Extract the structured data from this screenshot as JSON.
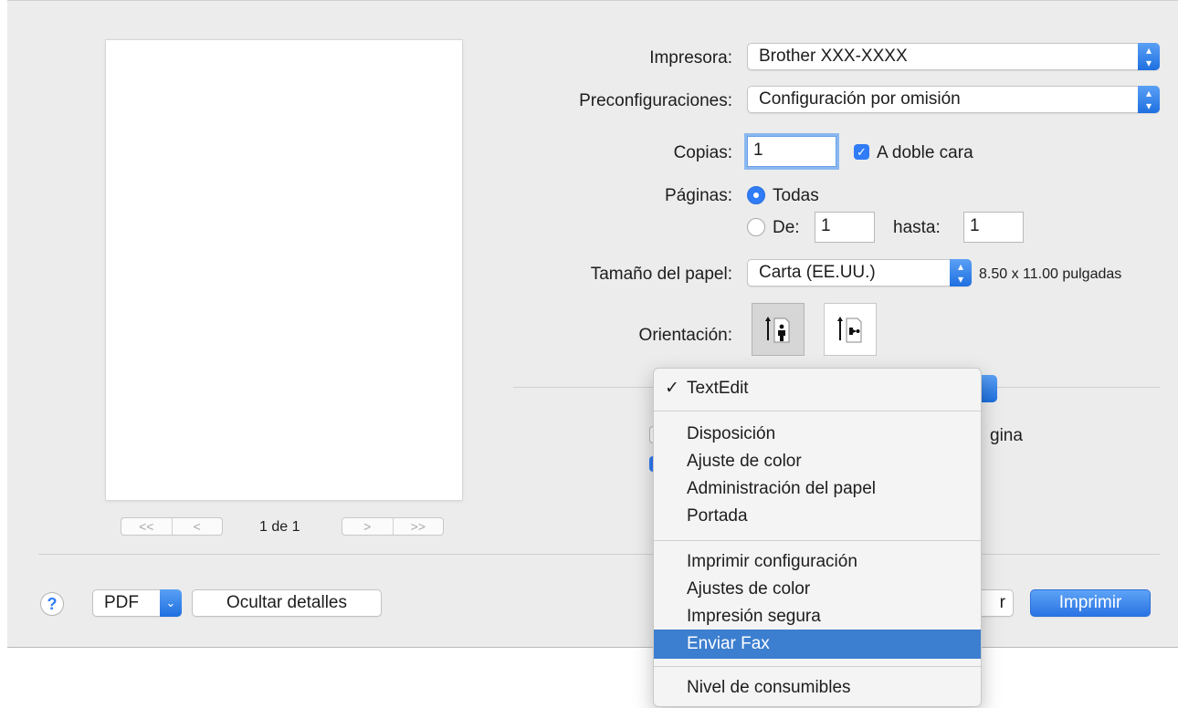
{
  "printer": {
    "label": "Impresora:",
    "value": "Brother XXX-XXXX"
  },
  "presets": {
    "label": "Preconfiguraciones:",
    "value": "Configuración por omisión"
  },
  "copies": {
    "label": "Copias:",
    "value": "1",
    "two_sided_label": "A doble cara",
    "two_sided_checked": true
  },
  "pages": {
    "label": "Páginas:",
    "all_label": "Todas",
    "from_label": "De:",
    "from_value": "1",
    "to_label": "hasta:",
    "to_value": "1"
  },
  "paper_size": {
    "label": "Tamaño del papel:",
    "value": "Carta (EE.UU.)",
    "dimensions": "8.50 x 11.00 pulgadas"
  },
  "orientation": {
    "label": "Orientación:",
    "selected": "portrait"
  },
  "preview": {
    "page_indicator": "1 de 1",
    "first": "<<",
    "prev": "<",
    "next": ">",
    "last": ">>"
  },
  "partial_behind_menu": {
    "right_text": "gina",
    "cancel_fragment": "r"
  },
  "menu": {
    "checked_item": "TextEdit",
    "check_mark": "✓",
    "group1": [
      "Disposición",
      "Ajuste de color",
      "Administración del papel",
      "Portada"
    ],
    "group2": [
      "Imprimir configuración",
      "Ajustes de color",
      "Impresión segura",
      "Enviar Fax"
    ],
    "group3": [
      "Nivel de consumibles"
    ],
    "highlighted": "Enviar Fax"
  },
  "footer": {
    "help": "?",
    "pdf_label": "PDF",
    "hide_details_label": "Ocultar detalles",
    "print_label": "Imprimir"
  },
  "colors": {
    "accent": "#2f7cf6",
    "menu_highlight": "#3c7ecf"
  }
}
